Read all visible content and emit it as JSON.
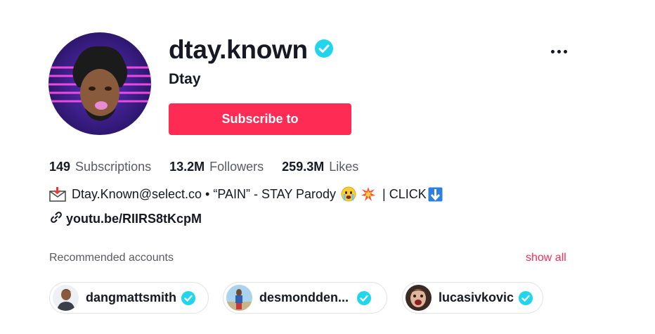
{
  "profile": {
    "username": "dtay.known",
    "nickname": "Dtay",
    "verified": true,
    "subscribe_label": "Subscribe to"
  },
  "stats": {
    "subscriptions_count": "149",
    "subscriptions_label": "Subscriptions",
    "followers_count": "13.2M",
    "followers_label": "Followers",
    "likes_count": "259.3M",
    "likes_label": "Likes"
  },
  "bio": {
    "text_main": "Dtay.Known@select.co • “PAIN” - STAY Parody",
    "text_end": "| CLICK",
    "icons": [
      "envelope-icon",
      "crying-face-emoji",
      "collision-emoji",
      "down-arrow-emoji"
    ]
  },
  "link": {
    "text": "youtu.be/RIIRS8tKcpM",
    "icon": "link-icon"
  },
  "recommended": {
    "title": "Recommended accounts",
    "show_all": "show all",
    "accounts": [
      {
        "name": "dangmattsmith",
        "verified": true
      },
      {
        "name": "desmondden...",
        "verified": true
      },
      {
        "name": "lucasivkovic",
        "verified": true
      }
    ]
  },
  "colors": {
    "accent": "#fe2c55",
    "verified": "#20d5ec",
    "text": "#161823",
    "muted": "#5a5b63"
  }
}
